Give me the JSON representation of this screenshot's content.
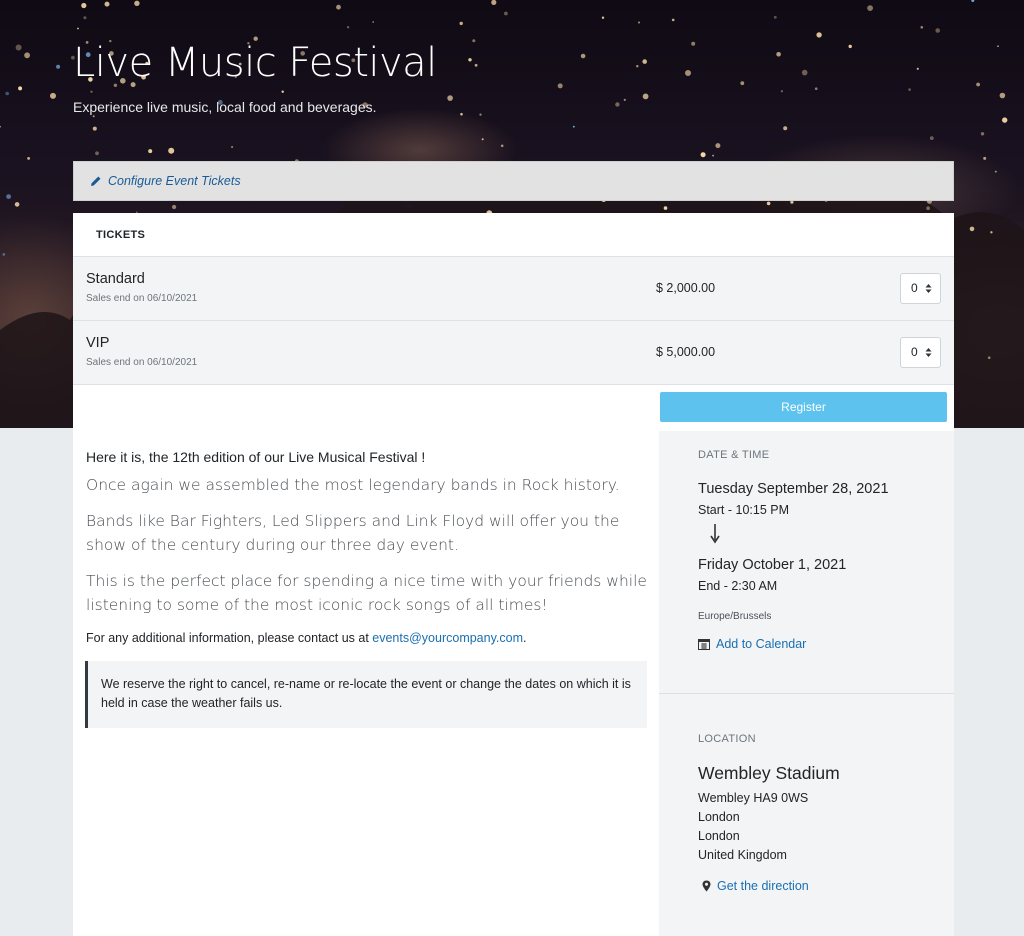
{
  "hero": {
    "title": "Live Music Festival",
    "subtitle": "Experience live music, local food and beverages."
  },
  "config": {
    "link_label": "Configure Event Tickets",
    "icon": "pencil-icon"
  },
  "tickets": {
    "header": "TICKETS",
    "rows": [
      {
        "name": "Standard",
        "sales_end": "Sales end on 06/10/2021",
        "price": "$ 2,000.00",
        "qty": "0"
      },
      {
        "name": "VIP",
        "sales_end": "Sales end on 06/10/2021",
        "price": "$ 5,000.00",
        "qty": "0"
      }
    ],
    "register_label": "Register"
  },
  "description": {
    "intro": "Here it is, the 12th edition of our Live Musical Festival !",
    "paragraphs": [
      "Once again we assembled the most legendary bands in Rock history.",
      "Bands like Bar Fighters, Led Slippers and Link Floyd will offer you the show of the century during our three day event.",
      "This is the perfect place for spending a nice time with your friends while listening to some of the most iconic rock songs of all times!"
    ],
    "contact_prefix": "For any additional information, please contact us at ",
    "contact_email": "events@yourcompany.com",
    "contact_suffix": ".",
    "note": "We reserve the right to cancel, re-name or re-locate the event or change the dates on which it is held in case the weather fails us."
  },
  "sidebar": {
    "date_label": "DATE & TIME",
    "start_date": "Tuesday September 28, 2021",
    "start_time": "Start - 10:15 PM",
    "end_date": "Friday October 1, 2021",
    "end_time": "End - 2:30 AM",
    "timezone": "Europe/Brussels",
    "calendar_label": "Add to Calendar",
    "location_label": "LOCATION",
    "venue": "Wembley Stadium",
    "address": [
      "Wembley HA9 0WS",
      "London",
      "London",
      "United Kingdom"
    ],
    "direction_label": "Get the direction"
  },
  "colors": {
    "accent": "#5dc3ee",
    "link": "#1a6fb0",
    "page_bg": "#e9ecef"
  }
}
